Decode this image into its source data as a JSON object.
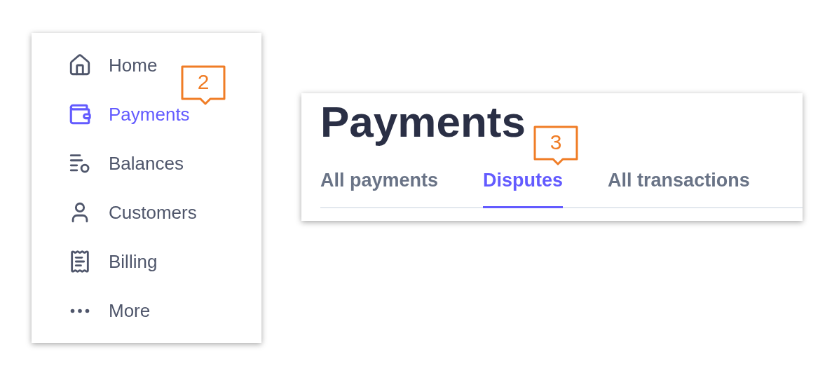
{
  "sidebar": {
    "items": [
      {
        "label": "Home",
        "selected": false
      },
      {
        "label": "Payments",
        "selected": true,
        "callout": "2"
      },
      {
        "label": "Balances",
        "selected": false
      },
      {
        "label": "Customers",
        "selected": false
      },
      {
        "label": "Billing",
        "selected": false
      },
      {
        "label": "More",
        "selected": false
      }
    ]
  },
  "page": {
    "title": "Payments",
    "tabs": [
      {
        "label": "All payments",
        "selected": false
      },
      {
        "label": "Disputes",
        "selected": true,
        "callout": "3"
      },
      {
        "label": "All transactions",
        "selected": false
      }
    ]
  }
}
